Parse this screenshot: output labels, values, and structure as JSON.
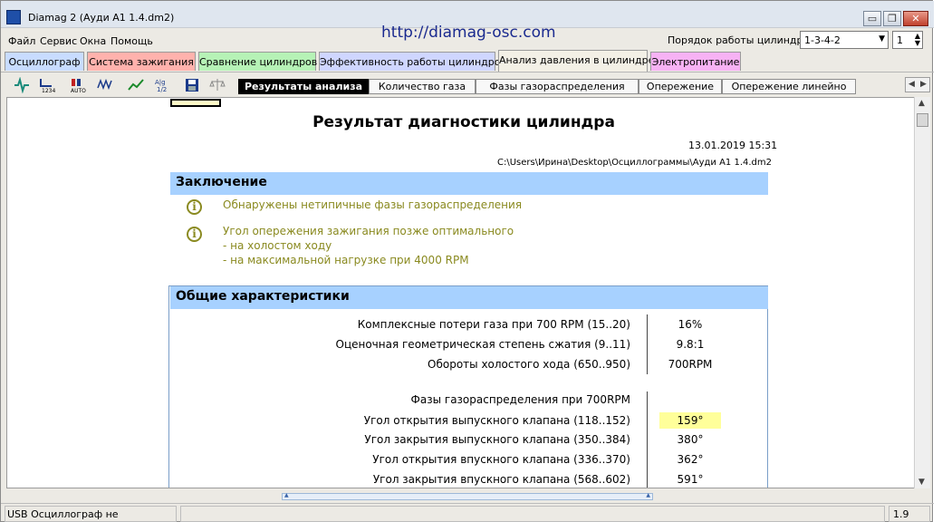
{
  "window": {
    "title": "Diamag 2 (Ауди А1 1.4.dm2)"
  },
  "caption": {
    "minimize": "▭",
    "maximize": "❐",
    "close": "✕"
  },
  "menu": [
    "Файл",
    "Сервис",
    "Окна",
    "Помощь"
  ],
  "url": "http://diamag-osc.com",
  "order": {
    "label": "Порядок работы цилиндров",
    "value": "1-3-4-2",
    "cylinder": "1"
  },
  "tabs": [
    {
      "label": "Осциллограф",
      "color": "#c8dcff"
    },
    {
      "label": "Система зажигания",
      "color": "#ffb2ad"
    },
    {
      "label": "Сравнение цилиндров",
      "color": "#b6f2b6"
    },
    {
      "label": "Эффективность работы цилиндров",
      "color": "#cfd6ff"
    },
    {
      "label": "Анализ давления в цилиндре",
      "color": "#f3f0e6"
    },
    {
      "label": "Электропитание",
      "color": "#f7b2f4"
    }
  ],
  "toolbar_icons": [
    "oscillograph-icon",
    "numbering-icon",
    "cylinder-auto-icon",
    "waveform-icon",
    "trend-icon",
    "ratio-icon",
    "save-icon",
    "scales-icon"
  ],
  "subtabs": [
    "Результаты анализа",
    "Количество газа",
    "Фазы газораспределения",
    "Опережение",
    "Опережение линейно"
  ],
  "report": {
    "title": "Результат диагностики цилиндра",
    "date": "13.01.2019 15:31",
    "path": "C:\\Users\\Ирина\\Desktop\\Осциллограммы\\Ауди А1 1.4.dm2",
    "conclusion_title": "Заключение",
    "conclusions": [
      {
        "lines": [
          "Обнаружены нетипичные фазы газораспределения"
        ]
      },
      {
        "lines": [
          "Угол опережения зажигания позже оптимального",
          "- на холостом ходу",
          "- на максимальной нагрузке при 4000 RPM"
        ]
      }
    ],
    "general_title": "Общие характеристики",
    "rows": [
      {
        "label": "Комплексные потери газа при 700 RPM (15..20)",
        "value": "16%"
      },
      {
        "label": "Оценочная геометрическая степень сжатия (9..11)",
        "value": "9.8:1"
      },
      {
        "label": "Обороты холостого хода (650..950)",
        "value": "700RPM"
      }
    ],
    "phases_title": "Фазы газораспределения при 700RPM",
    "phase_rows": [
      {
        "label": "Угол открытия выпускного клапана (118..152)",
        "value": "159°",
        "highlight": true
      },
      {
        "label": "Угол закрытия выпускного клапана (350..384)",
        "value": "380°"
      },
      {
        "label": "Угол открытия впускного клапана (336..370)",
        "value": "362°"
      },
      {
        "label": "Угол закрытия впускного клапана (568..602)",
        "value": "591°"
      }
    ]
  },
  "status": {
    "usb": "USB Осциллограф не подключен",
    "version": "1.9"
  }
}
